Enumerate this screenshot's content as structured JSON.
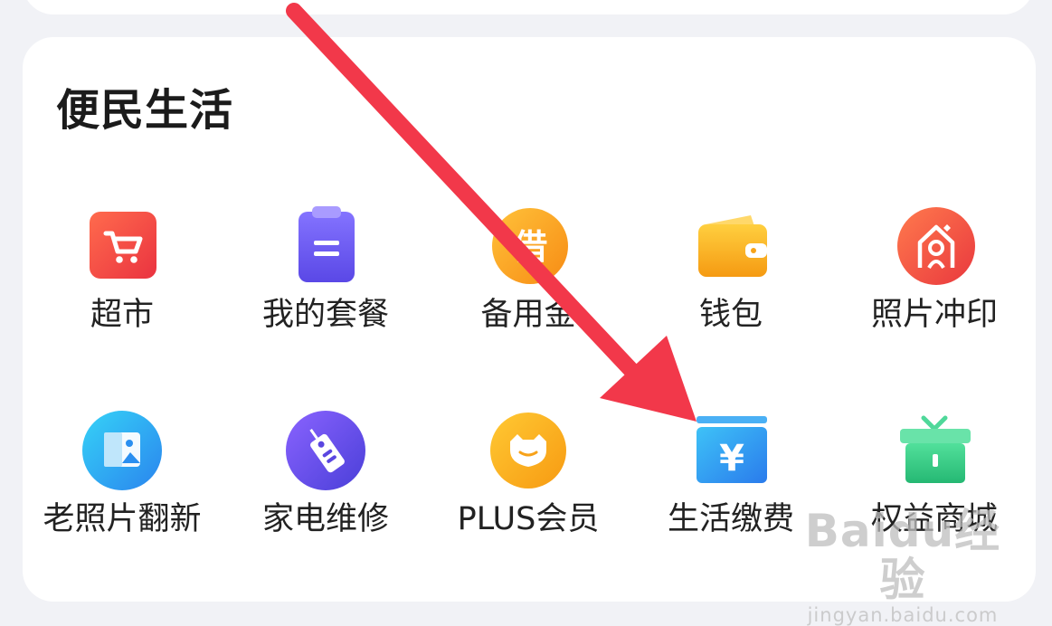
{
  "section": {
    "title": "便民生活"
  },
  "services": [
    {
      "label": "超市",
      "icon": "shopping-cart-icon"
    },
    {
      "label": "我的套餐",
      "icon": "clipboard-icon"
    },
    {
      "label": "备用金",
      "icon": "borrow-coin-icon"
    },
    {
      "label": "钱包",
      "icon": "wallet-icon"
    },
    {
      "label": "照片冲印",
      "icon": "photo-print-icon"
    },
    {
      "label": "老照片翻新",
      "icon": "photo-frame-icon"
    },
    {
      "label": "家电维修",
      "icon": "repair-tag-icon"
    },
    {
      "label": "PLUS会员",
      "icon": "plus-member-icon"
    },
    {
      "label": "生活缴费",
      "icon": "bill-payment-icon"
    },
    {
      "label": "权益商城",
      "icon": "gift-box-icon"
    }
  ],
  "watermark": {
    "logo": "Baidu经验",
    "url": "jingyan.baidu.com"
  },
  "colors": {
    "background": "#f1f2f6",
    "card": "#ffffff",
    "arrow": "#f2384a",
    "supermarket": "#f14a3e",
    "package": "#6b5bf0",
    "reserve": "#f9a723",
    "wallet": "#f6a516",
    "photo_print": "#f05a3c",
    "old_photo": "#2f9df2",
    "repair": "#6a4fe8",
    "plus": "#f6b11f",
    "bill": "#2f8ef2",
    "gift": "#34c981"
  }
}
